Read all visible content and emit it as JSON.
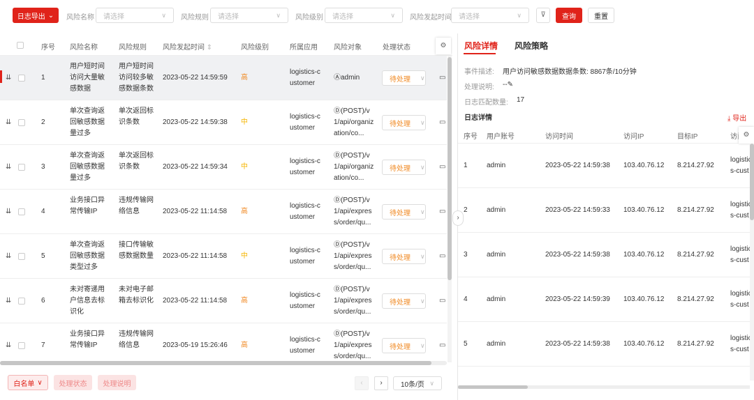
{
  "toolbar": {
    "export_label": "日志导出",
    "filters": [
      {
        "label": "风险名称",
        "placeholder": "请选择"
      },
      {
        "label": "风险规则",
        "placeholder": "请选择"
      },
      {
        "label": "风险级别",
        "placeholder": "请选择"
      },
      {
        "label": "风险发起时间",
        "placeholder": "请选择"
      }
    ],
    "query_label": "查询",
    "reset_label": "重置"
  },
  "table": {
    "headers": [
      "序号",
      "风险名称",
      "风险规则",
      "风险发起时间",
      "风险级别",
      "所属应用",
      "风险对象",
      "处理状态"
    ],
    "rows": [
      {
        "no": "1",
        "name": "用户短时间访问大量敏感数据",
        "rule": "用户短时间访问较多敏感数据条数",
        "time": "2023-05-22 14:59:59",
        "level": "高",
        "app": "logistics-customer",
        "target": "admin",
        "target_type": "user",
        "status": "待处理"
      },
      {
        "no": "2",
        "name": "单次查询返回敏感数据量过多",
        "rule": "单次返回标识条数",
        "time": "2023-05-22 14:59:38",
        "level": "中",
        "app": "logistics-customer",
        "target": "(POST)/v1/api/organization/co...",
        "target_type": "api",
        "status": "待处理"
      },
      {
        "no": "3",
        "name": "单次查询返回敏感数据量过多",
        "rule": "单次返回标识条数",
        "time": "2023-05-22 14:59:34",
        "level": "中",
        "app": "logistics-customer",
        "target": "(POST)/v1/api/organization/co...",
        "target_type": "api",
        "status": "待处理"
      },
      {
        "no": "4",
        "name": "业务接口异常传输IP",
        "rule": "违规传输网络信息",
        "time": "2023-05-22 11:14:58",
        "level": "高",
        "app": "logistics-customer",
        "target": "(POST)/v1/api/express/order/qu...",
        "target_type": "api",
        "status": "待处理"
      },
      {
        "no": "5",
        "name": "单次查询返回敏感数据类型过多",
        "rule": "接口传输敏感数据数量",
        "time": "2023-05-22 11:14:58",
        "level": "中",
        "app": "logistics-customer",
        "target": "(POST)/v1/api/express/order/qu...",
        "target_type": "api",
        "status": "待处理"
      },
      {
        "no": "6",
        "name": "未对寄递用户信息去标识化",
        "rule": "未对电子邮箱去标识化",
        "time": "2023-05-22 11:14:58",
        "level": "高",
        "app": "logistics-customer",
        "target": "(POST)/v1/api/express/order/qu...",
        "target_type": "api",
        "status": "待处理"
      },
      {
        "no": "7",
        "name": "业务接口异常传输IP",
        "rule": "违规传输网络信息",
        "time": "2023-05-19 15:26:46",
        "level": "高",
        "app": "logistics-customer",
        "target": "(POST)/v1/api/express/order/qu...",
        "target_type": "api",
        "status": "待处理"
      }
    ]
  },
  "footer": {
    "whitelist_label": "白名单",
    "status_label": "处理状态",
    "note_label": "处理说明",
    "page_size": "10条/页"
  },
  "detail": {
    "tabs": [
      "风险详情",
      "风险策略"
    ],
    "fields": [
      {
        "label": "事件描述:",
        "value": "用户访问敏感数据数据条数: 8867条/10分钟"
      },
      {
        "label": "处理说明:",
        "value": "--"
      },
      {
        "label": "日志匹配数量:",
        "value": "17"
      }
    ],
    "log_title": "日志详情",
    "export_label": "导出",
    "headers": [
      "序号",
      "用户账号",
      "访问时间",
      "访问IP",
      "目标IP",
      "访问"
    ],
    "rows": [
      {
        "no": "1",
        "user": "admin",
        "time": "2023-05-22 14:59:38",
        "ip": "103.40.76.12",
        "target_ip": "8.214.27.92",
        "app": "logistics-customer"
      },
      {
        "no": "2",
        "user": "admin",
        "time": "2023-05-22 14:59:33",
        "ip": "103.40.76.12",
        "target_ip": "8.214.27.92",
        "app": "logistics-customer"
      },
      {
        "no": "3",
        "user": "admin",
        "time": "2023-05-22 14:59:38",
        "ip": "103.40.76.12",
        "target_ip": "8.214.27.92",
        "app": "logistics-customer"
      },
      {
        "no": "4",
        "user": "admin",
        "time": "2023-05-22 14:59:39",
        "ip": "103.40.76.12",
        "target_ip": "8.214.27.92",
        "app": "logistics-customer"
      },
      {
        "no": "5",
        "user": "admin",
        "time": "2023-05-22 14:59:38",
        "ip": "103.40.76.12",
        "target_ip": "8.214.27.92",
        "app": "logistics-customer"
      }
    ]
  },
  "colors": {
    "accent": "#e0231a",
    "high": "#f08a24",
    "medium": "#f5b500"
  }
}
